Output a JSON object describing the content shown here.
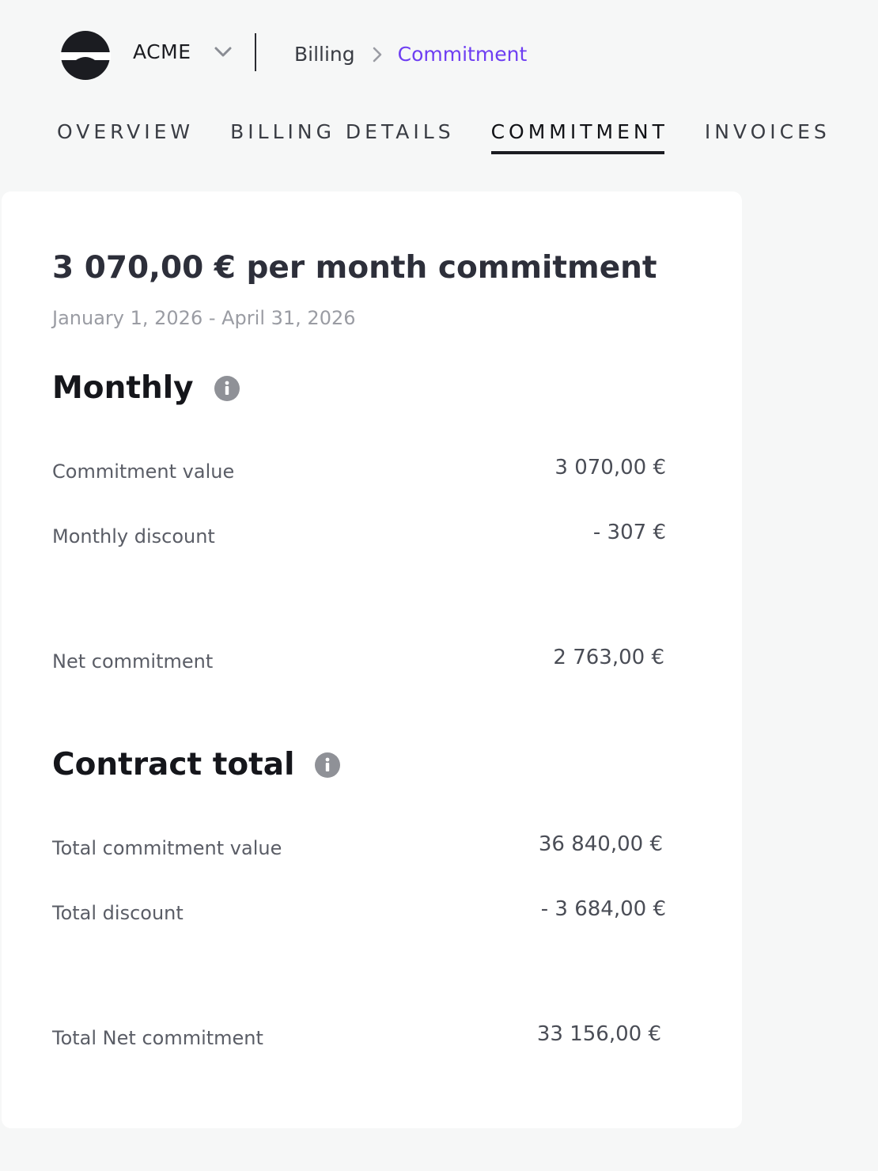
{
  "header": {
    "org_name": "ACME",
    "breadcrumb": {
      "parent": "Billing",
      "current": "Commitment"
    }
  },
  "tabs": [
    {
      "label": "OVERVIEW",
      "active": false
    },
    {
      "label": "BILLING DETAILS",
      "active": false
    },
    {
      "label": "COMMITMENT",
      "active": true
    },
    {
      "label": "INVOICES",
      "active": false
    }
  ],
  "commitment": {
    "title": "3 070,00 € per month commitment",
    "period": "January 1, 2026 - April 31, 2026",
    "monthly": {
      "heading": "Monthly",
      "rows": [
        {
          "label": "Commitment value",
          "value": "3 070,00 €"
        },
        {
          "label": "Monthly discount",
          "value": "- 307 €"
        },
        {
          "label": "Net commitment",
          "value": "2 763,00 €"
        }
      ]
    },
    "contract_total": {
      "heading": "Contract total",
      "rows": [
        {
          "label": "Total commitment value",
          "value": "36 840,00 €"
        },
        {
          "label": "Total discount",
          "value": "- 3 684,00 €"
        },
        {
          "label": "Total Net commitment",
          "value": "33 156,00 €"
        }
      ]
    }
  },
  "colors": {
    "accent": "#6e3ef2",
    "background": "#f6f7f7",
    "card": "#ffffff",
    "info_icon": "#8f9197"
  }
}
